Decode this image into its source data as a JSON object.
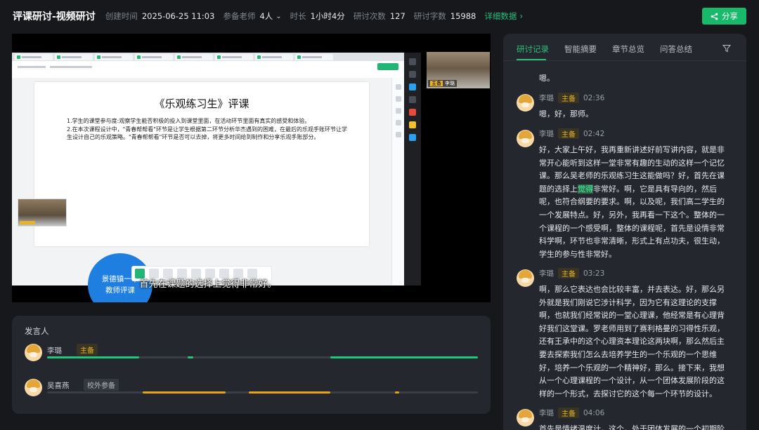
{
  "header": {
    "title": "评课研讨-视频研讨",
    "created_label": "创建时间",
    "created_value": "2025-06-25 11:03",
    "teachers_label": "参备老师",
    "teachers_value": "4人",
    "duration_label": "时长",
    "duration_value": "1小时4分",
    "discuss_count_label": "研讨次数",
    "discuss_count_value": "127",
    "discuss_words_label": "研讨字数",
    "discuss_words_value": "15988",
    "detail_link": "详细数据",
    "share_label": "分享"
  },
  "video": {
    "subtitle": "首先在课题的选择上觉得非常好。",
    "slide_title": "《乐观练习生》评课",
    "slide_points": [
      "1.学生的课堂参与度:观察学生能否积极的投入到课堂里面，在活动环节里面有真实的感受和体验。",
      "2.在本次课程设计中，\"青春帮帮看\"环节是让学生根据第二环节分析华杰遇到的困难，在最后的乐观手账环节让学生设计自己的乐观策略。\"青春帮帮看\"环节是否可以去掉，将更多时间给到制作和分享乐观手账部分。"
    ],
    "circle_lines": [
      "景德镇一中",
      "教师评课"
    ],
    "cam_right_name": "李璐",
    "cam_right_tag": "主备",
    "cam_left_tag": "主备"
  },
  "speakers": {
    "heading": "发言人",
    "rows": [
      {
        "name": "李璐",
        "badge": "主备",
        "color": "#1fc77a",
        "segments": [
          [
            0.0,
            0.214
          ],
          [
            0.326,
            0.339
          ],
          [
            0.658,
            1.0
          ]
        ]
      },
      {
        "name": "吴喜燕",
        "badge": "校外参备",
        "color": "#e8a317",
        "segments": [
          [
            0.222,
            0.414
          ],
          [
            0.468,
            0.657
          ],
          [
            0.808,
            0.818
          ]
        ]
      }
    ]
  },
  "transcript": {
    "tabs": [
      "研讨记录",
      "智能摘要",
      "章节总览",
      "问答总结"
    ],
    "active_tab": 0,
    "first_line": "嗯。",
    "messages": [
      {
        "speaker": "李璐",
        "tag": "主备",
        "time": "02:36",
        "text_before": "嗯，好，那师。",
        "highlight": "",
        "text_after": ""
      },
      {
        "speaker": "李璐",
        "tag": "主备",
        "time": "02:42",
        "text_before": "好，大家上午好，我再重新讲述好前写讲内容，就是非常开心能听到这样一堂非常有趣的生动的这样一个记忆课。那么吴老师的乐观练习生这能做吗？好，首先在课题的选择上",
        "highlight": "觉得",
        "text_after": "非常好。啊，它是具有导向的，然后呢，也符合纲要的要求。啊，以及呢，我们高二学生的一个发展特点。好，另外，我再看一下这个。整体的一个课程的一个感受啊，整体的课程呢，首先是设情非常科学啊，环节也非常清晰，形式上有点功夫，很生动，学生的参与性非常好。"
      },
      {
        "speaker": "李璐",
        "tag": "主备",
        "time": "03:23",
        "text_before": "啊，那么它表达也会比较丰富，并去表达。好，那么另外就是我们刚说它涉计科学，因为它有这理论的支撑啊，也就我们经常说的一堂心理课，他经常是有心理背好我们这堂课。罗老师用到了赛利格曼的习得性乐观，还有王承中的这个心理资本理论这两块啊，那么然后主要去探索我们怎么去培养学生的一个乐观的一个思维好，培养一个乐观的一个精神好，那么。接下来，我想从一个心理课程的一个设计，从一个团体发展阶段的这样的一个形式，去探讨它的这个每一个环节的设计。",
        "highlight": "",
        "text_after": ""
      },
      {
        "speaker": "李璐",
        "tag": "主备",
        "time": "04:06",
        "text_before": "首先是情绪温度计，这个，处于团体发展的一个初期阶",
        "highlight": "",
        "text_after": ""
      }
    ]
  },
  "colors": {
    "accent": "#19b96c",
    "host_badge": "#e7b32d",
    "panel_bg": "#24272d",
    "page_bg": "#16181c"
  }
}
